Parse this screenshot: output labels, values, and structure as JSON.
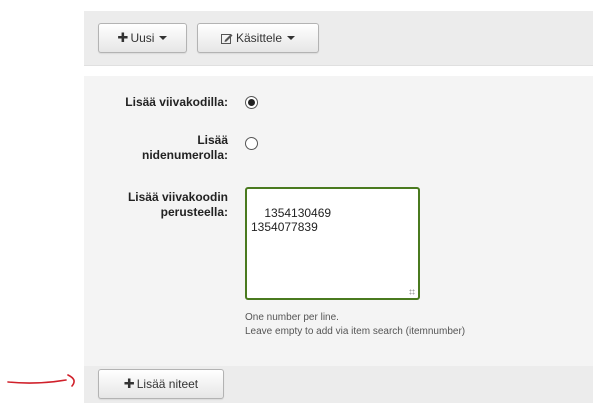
{
  "toolbar": {
    "new_label": "Uusi",
    "handle_label": "Käsittele"
  },
  "form": {
    "barcode_label": "Lisää viivakodilla:",
    "itemnumber_label_line1": "Lisää",
    "itemnumber_label_line2": "nidenumerolla:",
    "barcode_list_label_line1": "Lisää viivakoodin",
    "barcode_list_label_line2": "perusteella:",
    "selected_mode": "barcode",
    "barcodes_value": "1354130469\n1354077839",
    "hint_line1": "One number per line.",
    "hint_line2": "Leave empty to add via item search (itemnumber)"
  },
  "footer": {
    "add_items_label": "Lisää niteet"
  },
  "icons": {
    "new": "plus-icon",
    "handle": "edit-icon",
    "add": "plus-icon",
    "annotation": "red-arrow-icon"
  },
  "colors": {
    "textarea_border": "#4a7a1f",
    "annotation_arrow": "#d0202a"
  }
}
